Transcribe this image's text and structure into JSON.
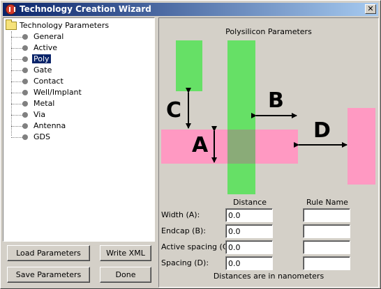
{
  "window": {
    "title": "Technology Creation Wizard",
    "close_glyph": "✕"
  },
  "tree": {
    "root_label": "Technology Parameters",
    "items": [
      {
        "label": "General"
      },
      {
        "label": "Active"
      },
      {
        "label": "Poly",
        "selected": true
      },
      {
        "label": "Gate"
      },
      {
        "label": "Contact"
      },
      {
        "label": "Well/Implant"
      },
      {
        "label": "Metal"
      },
      {
        "label": "Via"
      },
      {
        "label": "Antenna"
      },
      {
        "label": "GDS"
      }
    ]
  },
  "buttons": {
    "load_parameters": "Load Parameters",
    "write_xml": "Write XML",
    "save_parameters": "Save Parameters",
    "done": "Done"
  },
  "diagram": {
    "title": "Polysilicon Parameters",
    "letters": {
      "a": "A",
      "b": "B",
      "c": "C",
      "d": "D"
    },
    "colors": {
      "polysilicon": "#66e066",
      "active": "#ff99c2",
      "overlap": "#8aab78"
    }
  },
  "form": {
    "distance_header": "Distance",
    "rule_name_header": "Rule Name",
    "rows": [
      {
        "label": "Width (A):",
        "distance": "0.0",
        "rule_name": ""
      },
      {
        "label": "Endcap (B):",
        "distance": "0.0",
        "rule_name": ""
      },
      {
        "label": "Active spacing (C):",
        "distance": "0.0",
        "rule_name": ""
      },
      {
        "label": "Spacing (D):",
        "distance": "0.0",
        "rule_name": ""
      }
    ],
    "footnote": "Distances are in nanometers"
  }
}
